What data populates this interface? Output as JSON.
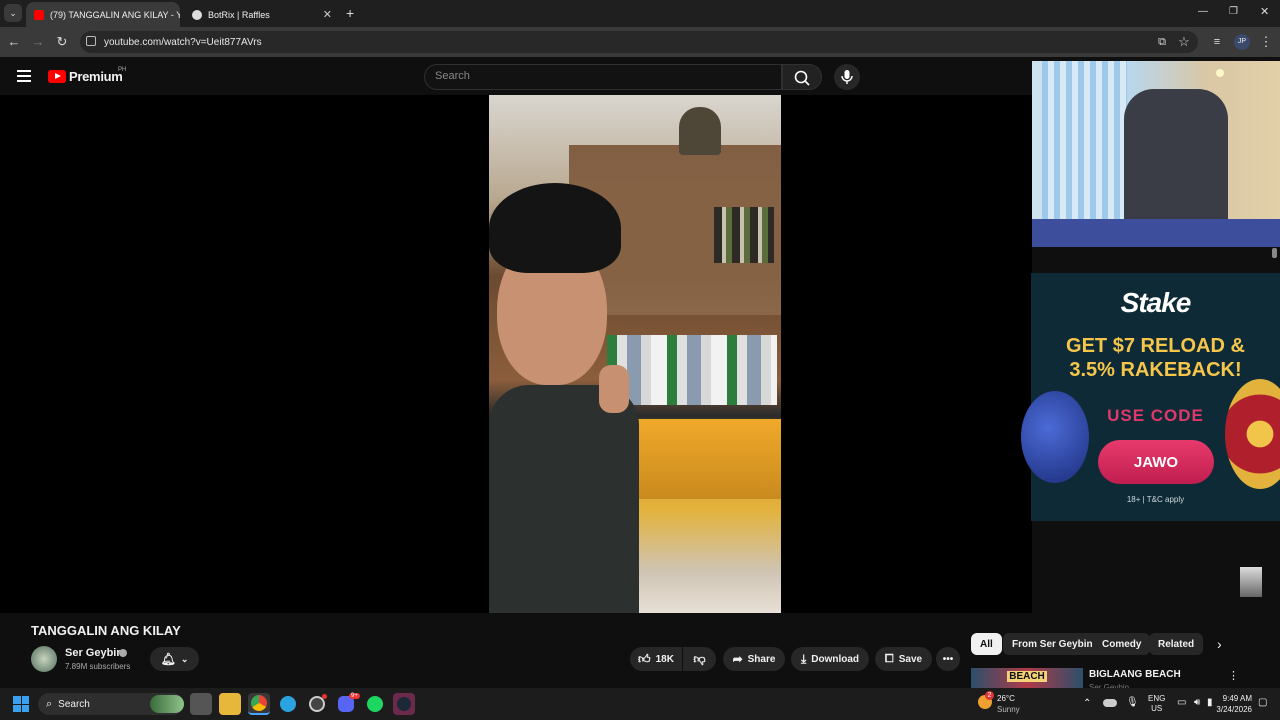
{
  "browser": {
    "tabs": [
      {
        "label": "(79) TANGGALIN ANG KILAY - Y",
        "active": true
      },
      {
        "label": "BotRix | Raffles",
        "active": false
      }
    ],
    "new_tab": "+",
    "url": "youtube.com/watch?v=Ueit877AVrs",
    "profile_initials": "JP"
  },
  "youtube": {
    "logo_text": "Premium",
    "region": "PH",
    "search_placeholder": "Search"
  },
  "video": {
    "title": "TANGGALIN ANG KILAY",
    "channel": "Ser Geybin",
    "subscribers": "7.89M subscribers",
    "likes": "18K",
    "share": "Share",
    "download": "Download",
    "save": "Save"
  },
  "ad": {
    "brand": "Stake",
    "headline1": "GET $7 RELOAD &",
    "headline2": "3.5% RAKEBACK!",
    "use_code": "USE CODE",
    "code": "JAWO",
    "disclaimer": "18+ | T&C apply"
  },
  "chips": [
    "All",
    "From Ser Geybin",
    "Comedy",
    "Related"
  ],
  "suggested": {
    "title": "BIGLAANG BEACH",
    "thumb_text": "BEACH",
    "channel": "Ser Geybin"
  },
  "taskbar": {
    "search": "Search",
    "weather_temp": "26°C",
    "weather_desc": "Sunny",
    "weather_badge": "2",
    "lang1": "ENG",
    "lang2": "US",
    "time": "9:49 AM",
    "date": "3/24/2026",
    "discord_badge": "9+"
  }
}
